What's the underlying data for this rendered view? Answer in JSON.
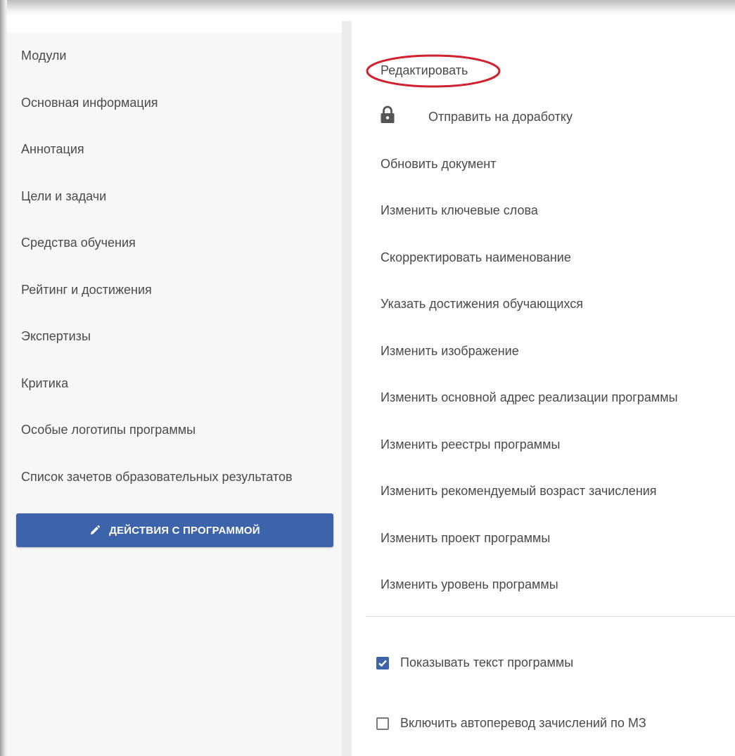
{
  "sidebar": {
    "items": [
      {
        "label": "Модули"
      },
      {
        "label": "Основная информация"
      },
      {
        "label": "Аннотация"
      },
      {
        "label": "Цели и задачи"
      },
      {
        "label": "Средства обучения"
      },
      {
        "label": "Рейтинг и достижения"
      },
      {
        "label": "Экспертизы"
      },
      {
        "label": "Критика"
      },
      {
        "label": "Особые логотипы программы"
      },
      {
        "label": "Список зачетов образовательных результатов"
      }
    ],
    "actions_button": {
      "label": "ДЕЙСТВИЯ С ПРОГРАММОЙ",
      "icon": "pencil-icon",
      "color": "#3d63aa"
    }
  },
  "menu": {
    "items": [
      {
        "label": "Редактировать",
        "highlighted": true
      },
      {
        "label": "Отправить на доработку",
        "icon": "lock-icon"
      },
      {
        "label": "Обновить документ"
      },
      {
        "label": "Изменить ключевые слова"
      },
      {
        "label": "Скорректировать наименование"
      },
      {
        "label": "Указать достижения обучающихся"
      },
      {
        "label": "Изменить изображение"
      },
      {
        "label": "Изменить основной адрес реализации программы"
      },
      {
        "label": "Изменить реестры программы"
      },
      {
        "label": "Изменить рекомендуемый возраст зачисления"
      },
      {
        "label": "Изменить проект программы"
      },
      {
        "label": "Изменить уровень программы"
      }
    ],
    "highlight_color": "#d0212f"
  },
  "options": [
    {
      "label": "Показывать текст программы",
      "checked": true
    },
    {
      "label": "Включить автоперевод зачислений по МЗ",
      "checked": false
    }
  ]
}
